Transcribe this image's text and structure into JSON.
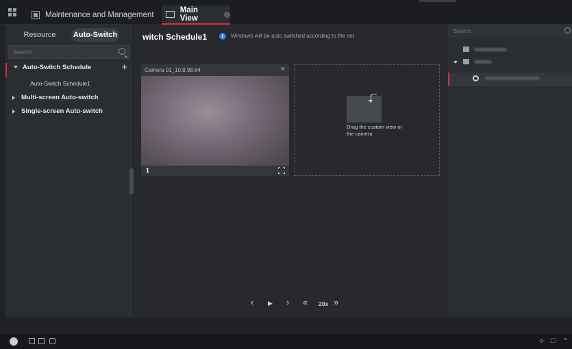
{
  "topbar": {
    "tabs": [
      {
        "label": "Maintenance and Management"
      },
      {
        "label": "Main View"
      }
    ]
  },
  "left_panel": {
    "tabs": {
      "resource": "Resource",
      "auto_switch": "Auto-Switch"
    },
    "search_placeholder": "Search",
    "tree": {
      "schedule": "Auto-Switch Schedule",
      "schedule_child": "Auto-Switch Schedule1",
      "multi": "Multi-screen Auto-switch",
      "single": "Single-screen Auto-switch",
      "add_symbol": "+"
    }
  },
  "main": {
    "title": "witch Schedule1",
    "info_icon": "i",
    "info_text": "Windows will be auto switched according to the set",
    "window1": {
      "camera": "Camera 01_10.8.98.64",
      "close_symbol": "×",
      "index": "1"
    },
    "window2": {
      "drag_text": "Drag the custom view or the camera"
    },
    "controls": {
      "prev": "‹",
      "play": "▶",
      "next": "›",
      "rewind": "«",
      "interval": "20s",
      "forward": "»"
    }
  },
  "right_panel": {
    "search_placeholder": "Search"
  },
  "colors": {
    "accent": "#d9313c",
    "info": "#2b7de9"
  }
}
